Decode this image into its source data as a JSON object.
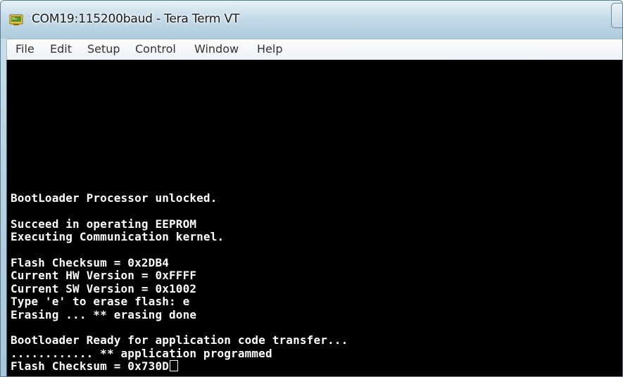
{
  "window": {
    "title": "COM19:115200baud - Tera Term VT",
    "icon": "tera-term-icon"
  },
  "menu": {
    "items": [
      "File",
      "Edit",
      "Setup",
      "Control",
      "Window",
      "Help"
    ]
  },
  "terminal": {
    "lines": [
      "BootLoader Processor unlocked.",
      "",
      "Succeed in operating EEPROM",
      "Executing Communication kernel.",
      "",
      "Flash Checksum = 0x2DB4",
      "Current HW Version = 0xFFFF",
      "Current SW Version = 0x1002",
      "Type 'e' to erase flash: e",
      "Erasing ... ** erasing done",
      "",
      "Bootloader Ready for application code transfer...",
      "............ ** application programmed",
      "Flash Checksum = 0x730D"
    ]
  }
}
